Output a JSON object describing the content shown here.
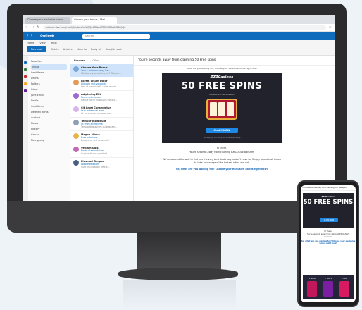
{
  "browser": {
    "tabs": [
      "Choose your exclusive bonus...",
      "Choose your bonus - Mail"
    ],
    "url": "outlook.live.com/mail/0/inbox/id/AQQkADAwATM0MDAAMS1iYjQ0"
  },
  "outlook": {
    "brand": "Outlook",
    "search_placeholder": "Search",
    "ribbon_tabs": [
      "Home",
      "View",
      "Help"
    ],
    "new_mail": "New mail",
    "tools": [
      "Delete",
      "Archive",
      "Move to",
      "Reply all",
      "Read/Unread"
    ],
    "folders": [
      "Favorites",
      "Inbox",
      "Sent Items",
      "Drafts",
      "Folders",
      "Inbox",
      "Junk Email",
      "Drafts",
      "Sent Items",
      "Deleted Items",
      "Archive",
      "Notes",
      "History",
      "Groups",
      "New group"
    ],
    "list_tabs": [
      "Focused",
      "Other"
    ],
    "messages": [
      {
        "sender": "Choose Your Bonus",
        "subject": "You're seconds away fro...",
        "preview": "What are you waiting for? Choose..."
      },
      {
        "sender": "Lorem Ipsum Dolor",
        "subject": "Aliquam erat volutpat",
        "preview": "Sed ut perspiciatis unde omnis..."
      },
      {
        "sender": "Adipiscing Elit",
        "subject": "Nemo enim ipsam",
        "preview": "Neque porro quisquam est qui..."
      },
      {
        "sender": "Sit Amet Consectetur",
        "subject": "Quis autem vel eum",
        "preview": "At vero eos et accusamus..."
      },
      {
        "sender": "Tempor Incididunt",
        "subject": "Ut enim ad minima",
        "preview": "Temporibus autem quibusdam..."
      },
      {
        "sender": "Magna Aliqua",
        "subject": "Duis aute irure",
        "preview": "Excepteur sint occaecat..."
      },
      {
        "sender": "Veniam Quis",
        "subject": "Nostrud exercitation",
        "preview": "Cupidatat non proident..."
      },
      {
        "sender": "Eiusmod Tempor",
        "subject": "Labore et dolore",
        "preview": "Sunt in culpa qui officia..."
      }
    ],
    "reading_subject": "You're seconds away from claiming 50 Free spins"
  },
  "email": {
    "view_link": "What are you waiting for? Choose your exclusive bonus right now!",
    "logo": "ZZZCasinos",
    "title": "50 FREE SPINS",
    "subtitle": "NO DEPOSIT REQUIRED",
    "claim": "CLAIM NOW",
    "fine_print": "T&Cs apply. 18+ only. Gamble responsibly.",
    "greeting": "Hi there,",
    "line1": "You're seconds away from claiming EXCLUSIVE Bonuses",
    "line2": "We've scoured the web to find you the very best deals so you don't have to. Simply take a look below to take advantage of the hottest offers around.",
    "question": "So, what are you waiting for? Choose your exclusive bonus right now!"
  },
  "phone": {
    "header": "You're seconds away from claiming 50 Free spins",
    "games": [
      "1. GAME",
      "2. SLOTS",
      "3. PLAY"
    ]
  },
  "colors": {
    "outlook_blue": "#0f6cbd",
    "claim_blue": "#1e88e5",
    "hero_dark": "#22222c",
    "slot_red": "#b0182f"
  }
}
